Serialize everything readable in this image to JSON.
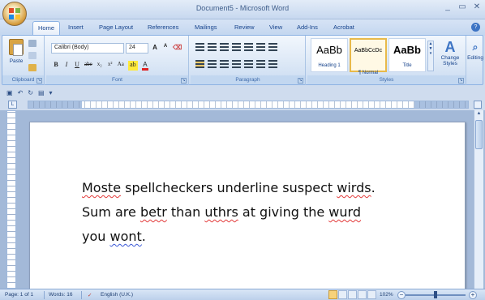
{
  "window": {
    "title": "Document5 - Microsoft Word",
    "controls": {
      "minimize": "_",
      "maximize": "▭",
      "close": "✕"
    }
  },
  "tabs": [
    {
      "label": "Home",
      "active": true
    },
    {
      "label": "Insert"
    },
    {
      "label": "Page Layout"
    },
    {
      "label": "References"
    },
    {
      "label": "Mailings"
    },
    {
      "label": "Review"
    },
    {
      "label": "View"
    },
    {
      "label": "Add-Ins"
    },
    {
      "label": "Acrobat"
    }
  ],
  "ribbon": {
    "clipboard": {
      "label": "Clipboard",
      "paste_label": "Paste"
    },
    "font": {
      "label": "Font",
      "font_name": "Calibri (Body)",
      "font_size": "24",
      "grow": "A",
      "shrink": "A",
      "bold": "B",
      "italic": "I",
      "underline": "U",
      "strike": "abe",
      "subscript": "x₂",
      "superscript": "x²",
      "case": "Aa"
    },
    "paragraph": {
      "label": "Paragraph"
    },
    "styles": {
      "label": "Styles",
      "items": [
        {
          "sample": "AaBb",
          "name": "Heading 1"
        },
        {
          "sample": "AaBbCcDc",
          "name": "¶ Normal"
        },
        {
          "sample": "AaBb",
          "name": "Title"
        }
      ],
      "change_styles": "Change Styles"
    },
    "editing": {
      "label": "Editing"
    }
  },
  "document": {
    "lines": [
      [
        {
          "text": "Moste",
          "mark": "spell"
        },
        {
          "text": " spellcheckers underline suspect ",
          "mark": ""
        },
        {
          "text": "wirds",
          "mark": "spell"
        },
        {
          "text": ".",
          "mark": ""
        }
      ],
      [
        {
          "text": "Sum are ",
          "mark": ""
        },
        {
          "text": "betr",
          "mark": "spell"
        },
        {
          "text": " than ",
          "mark": ""
        },
        {
          "text": "uthrs",
          "mark": "spell"
        },
        {
          "text": " at giving the ",
          "mark": ""
        },
        {
          "text": "wurd",
          "mark": "spell"
        }
      ],
      [
        {
          "text": "you ",
          "mark": ""
        },
        {
          "text": "wont",
          "mark": "grammar"
        },
        {
          "text": ".",
          "mark": ""
        }
      ]
    ]
  },
  "statusbar": {
    "page": "Page: 1 of 1",
    "words": "Words: 16",
    "language": "English (U.K.)",
    "zoom": "102%"
  },
  "colors": {
    "spell_underline": "#e23a3a",
    "grammar_underline": "#3a58d6",
    "ribbon_accent": "#15428b"
  }
}
